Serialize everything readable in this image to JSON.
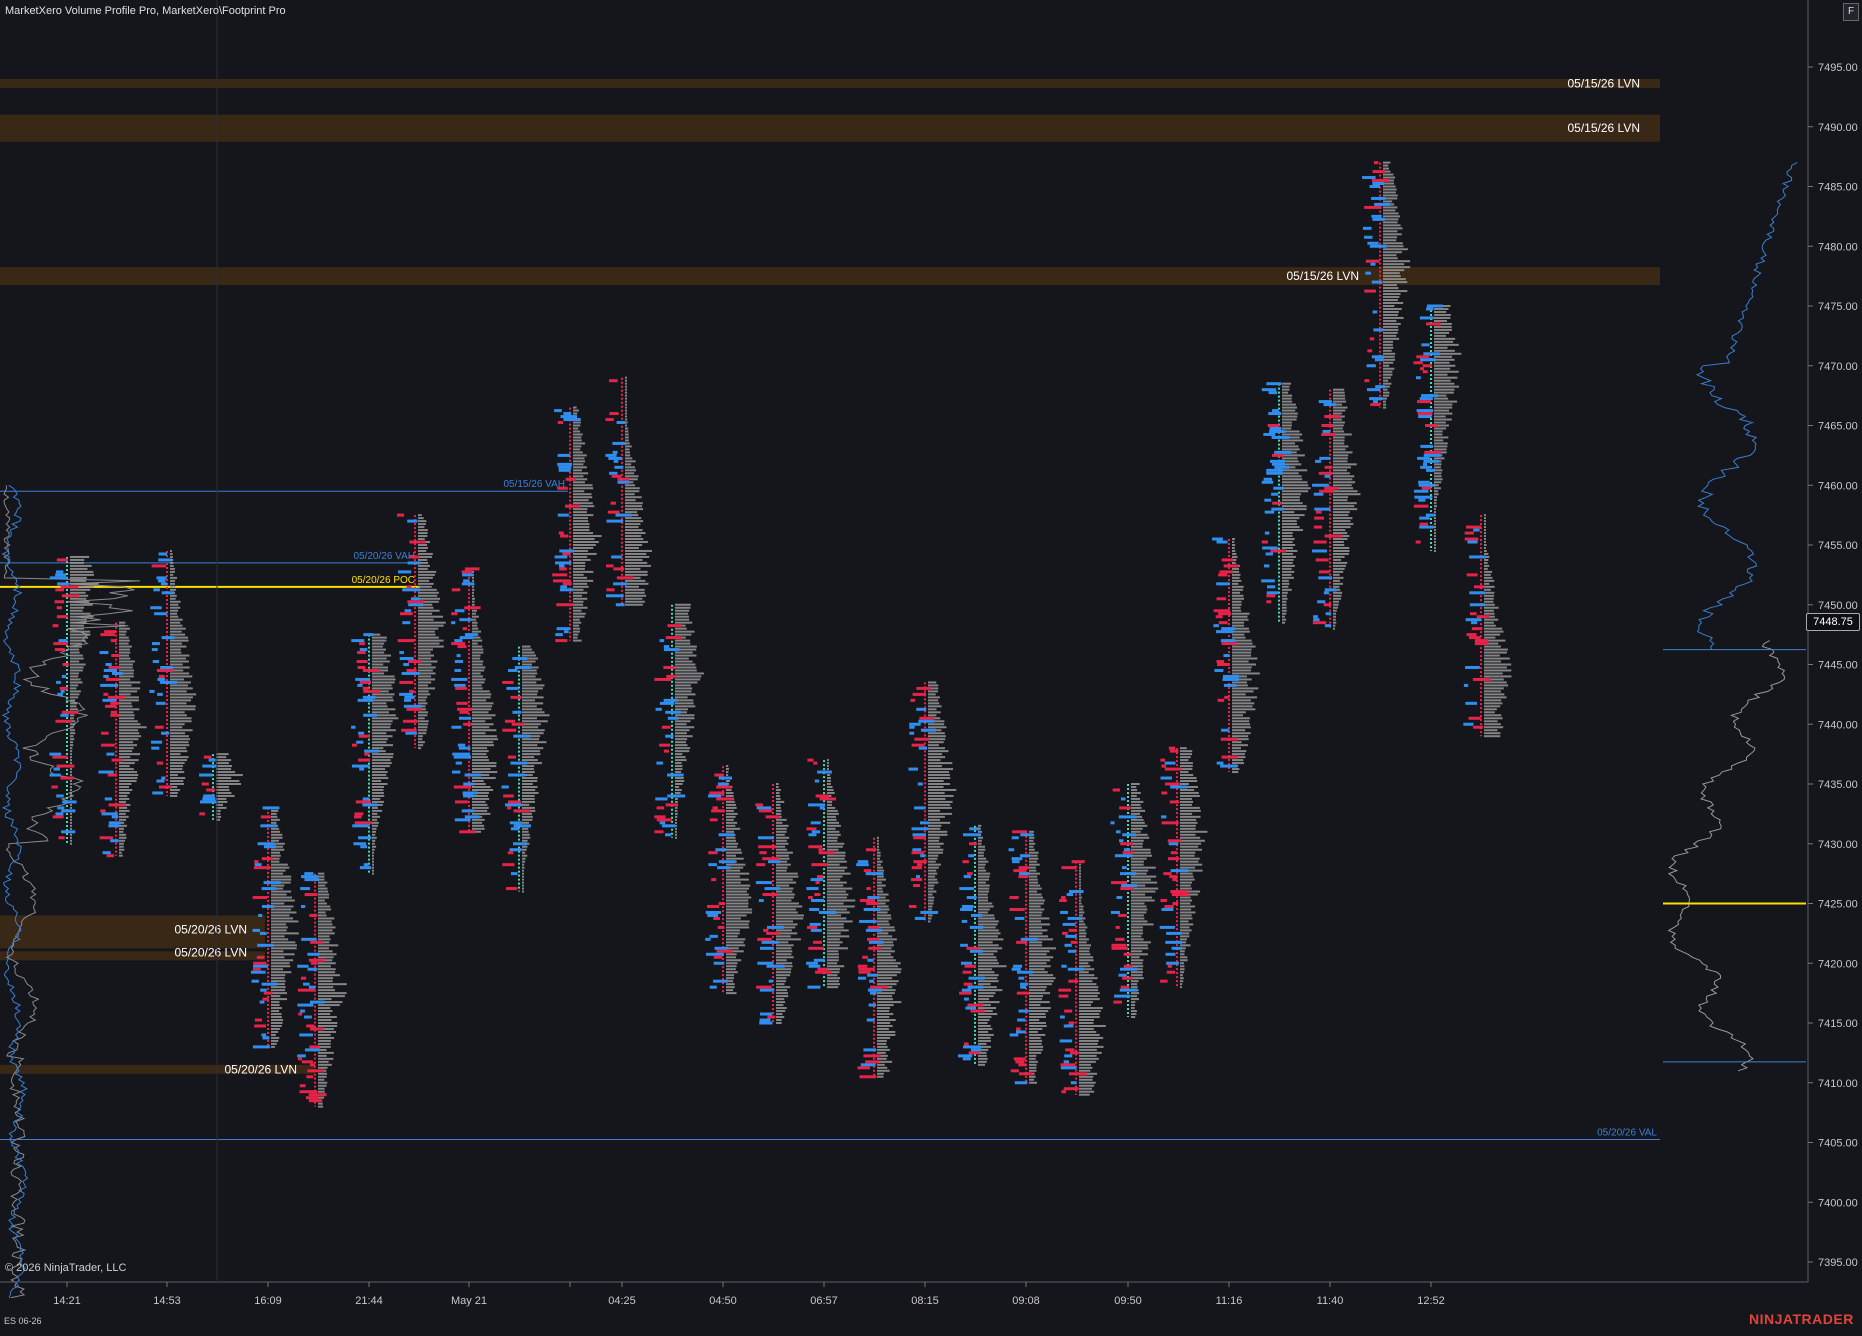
{
  "header": {
    "indicators_label": "MarketXero Volume Profile Pro, MarketXero\\Footprint Pro"
  },
  "toolbar": {
    "f_button_label": "F"
  },
  "footer": {
    "copyright": "© 2026 NinjaTrader, LLC",
    "instrument": "ES 06-26",
    "brand": "NINJATRADER"
  },
  "colors": {
    "background": "#14161c",
    "bid": "#e8234a",
    "ask": "#2f8ff0",
    "poc": "#ffe000",
    "value_area": "#3f7fd6",
    "lvn_zone": "#3a2817",
    "profile": "#999999",
    "delta_dots": "#46d8b0"
  },
  "price_axis": {
    "labels": [
      "7495.00",
      "7490.00",
      "7485.00",
      "7480.00",
      "7475.00",
      "7470.00",
      "7465.00",
      "7460.00",
      "7455.00",
      "7450.00",
      "7445.00",
      "7440.00",
      "7435.00",
      "7430.00",
      "7425.00",
      "7420.00",
      "7415.00",
      "7410.00",
      "7405.00",
      "7400.00",
      "7395.00"
    ],
    "last_price": "7448.75"
  },
  "time_axis": {
    "labels": [
      "14:21",
      "14:53",
      "16:09",
      "21:44",
      "May 21",
      "04:25",
      "04:50",
      "06:57",
      "08:15",
      "09:08",
      "09:50",
      "11:16",
      "11:40",
      "12:52"
    ]
  },
  "levels": [
    {
      "label": "05/15/26 LVN",
      "top": 7494.0,
      "bottom": 7493.25,
      "kind": "lvn"
    },
    {
      "label": "05/15/26 LVN",
      "top": 7491.0,
      "bottom": 7488.75,
      "kind": "lvn"
    },
    {
      "label": "05/15/26 LVN",
      "top": 7478.25,
      "bottom": 7476.75,
      "kind": "lvn"
    },
    {
      "label": "05/20/26 LVN",
      "top": 7424.0,
      "bottom": 7421.25,
      "kind": "lvn"
    },
    {
      "label": "05/20/26 LVN",
      "top": 7421.0,
      "bottom": 7420.25,
      "kind": "lvn"
    },
    {
      "label": "05/20/26 LVN",
      "top": 7411.5,
      "bottom": 7410.75,
      "kind": "lvn"
    },
    {
      "label": "05/15/26 VAH",
      "price": 7459.5,
      "kind": "vah"
    },
    {
      "label": "05/20/26 VAH",
      "price": 7453.5,
      "kind": "vah"
    },
    {
      "label": "05/20/26 POC",
      "price": 7451.5,
      "kind": "poc"
    },
    {
      "label": "05/20/26 VAL",
      "price": 7405.25,
      "kind": "val"
    }
  ],
  "chart_data": {
    "type": "footprint",
    "columns": [
      {
        "high": 7454.0,
        "low": 7430.0,
        "poc": 7452.0
      },
      {
        "high": 7448.5,
        "low": 7429.0,
        "poc": 7440.0
      },
      {
        "high": 7454.5,
        "low": 7434.0,
        "poc": 7442.0
      },
      {
        "high": 7437.5,
        "low": 7432.0,
        "poc": 7435.5
      },
      {
        "high": 7433.0,
        "low": 7413.0,
        "poc": 7423.0
      },
      {
        "high": 7427.5,
        "low": 7408.0,
        "poc": 7418.0
      },
      {
        "high": 7447.5,
        "low": 7427.5,
        "poc": 7441.0
      },
      {
        "high": 7457.5,
        "low": 7438.0,
        "poc": 7448.0
      },
      {
        "high": 7453.0,
        "low": 7431.0,
        "poc": 7438.0
      },
      {
        "high": 7446.5,
        "low": 7426.0,
        "poc": 7440.0
      },
      {
        "high": 7466.5,
        "low": 7447.0,
        "poc": 7456.0
      },
      {
        "high": 7469.0,
        "low": 7450.0,
        "poc": 7454.0
      },
      {
        "high": 7450.0,
        "low": 7430.5,
        "poc": 7444.0
      },
      {
        "high": 7436.5,
        "low": 7417.5,
        "poc": 7425.0
      },
      {
        "high": 7435.0,
        "low": 7415.0,
        "poc": 7424.0
      },
      {
        "high": 7437.0,
        "low": 7418.0,
        "poc": 7425.0
      },
      {
        "high": 7430.5,
        "low": 7410.5,
        "poc": 7418.0
      },
      {
        "high": 7443.5,
        "low": 7423.5,
        "poc": 7435.0
      },
      {
        "high": 7431.5,
        "low": 7411.5,
        "poc": 7420.0
      },
      {
        "high": 7431.0,
        "low": 7410.0,
        "poc": 7420.0
      },
      {
        "high": 7428.5,
        "low": 7409.0,
        "poc": 7414.0
      },
      {
        "high": 7435.0,
        "low": 7415.5,
        "poc": 7426.0
      },
      {
        "high": 7438.0,
        "low": 7418.0,
        "poc": 7430.0
      },
      {
        "high": 7455.5,
        "low": 7436.0,
        "poc": 7444.0
      },
      {
        "high": 7468.5,
        "low": 7448.5,
        "poc": 7460.0
      },
      {
        "high": 7468.0,
        "low": 7448.0,
        "poc": 7460.0
      },
      {
        "high": 7487.0,
        "low": 7466.5,
        "poc": 7478.0
      },
      {
        "high": 7475.0,
        "low": 7454.5,
        "poc": 7470.0
      },
      {
        "high": 7457.5,
        "low": 7439.0,
        "poc": 7444.0
      }
    ]
  }
}
